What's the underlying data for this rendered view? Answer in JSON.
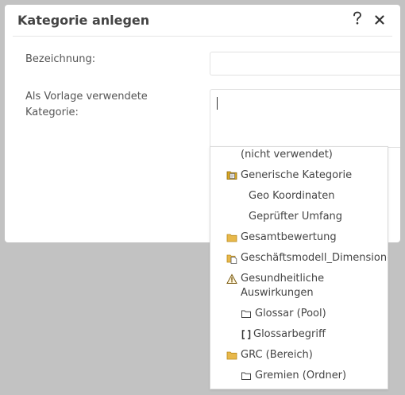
{
  "dialog": {
    "title": "Kategorie anlegen",
    "help_label": "?",
    "close_label": "×"
  },
  "form": {
    "name_label": "Bezeichnung:",
    "name_value": "",
    "template_label_line1": "Als Vorlage verwendete",
    "template_label_line2": "Kategorie:",
    "template_value": ""
  },
  "dropdown": {
    "items": [
      {
        "label": "(nicht verwendet)",
        "icon": "none"
      },
      {
        "label": "Generische Kategorie",
        "icon": "folder-generic-icon"
      },
      {
        "label": "Geo Koordinaten",
        "icon": "none"
      },
      {
        "label": "Geprüfter Umfang",
        "icon": "none"
      },
      {
        "label": "Gesamtbewertung",
        "icon": "folder-icon"
      },
      {
        "label": "Geschäftsmodell_Dimensionen",
        "icon": "folder-document-icon"
      },
      {
        "label_line1": "Gesundheitliche",
        "label_line2": "Auswirkungen",
        "icon": "warning-icon"
      },
      {
        "label": "Glossar (Pool)",
        "icon": "folder-outline-icon"
      },
      {
        "label": "Glossarbegriff",
        "icon": "brackets-icon"
      },
      {
        "label": "GRC (Bereich)",
        "icon": "folder-icon"
      },
      {
        "label": "Gremien (Ordner)",
        "icon": "folder-outline-icon"
      }
    ]
  }
}
